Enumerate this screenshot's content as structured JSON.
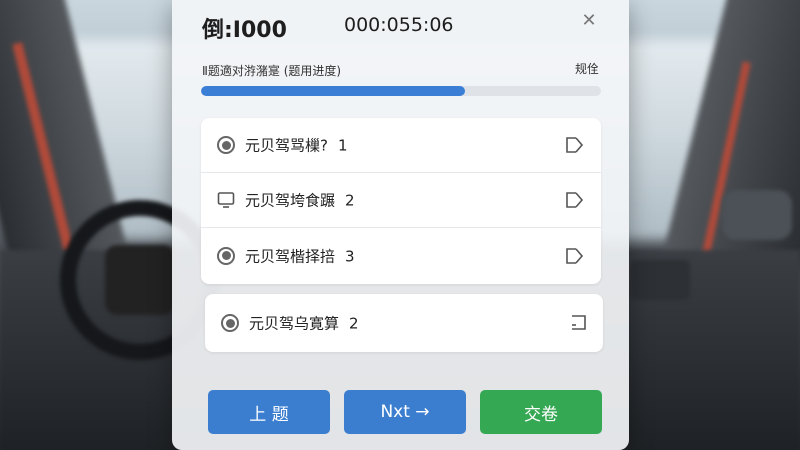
{
  "header": {
    "title": "倒:Ⅰ000",
    "timer": "000:055:06"
  },
  "progress": {
    "label": "Ⅱ题適对㳺潴寔 (题用进度)",
    "right_label": "规佺",
    "percent": 66,
    "fill_color": "#3a7fd5"
  },
  "questions": [
    {
      "icon": "radio-icon",
      "label": "元贝驾骂樔?",
      "number": "1",
      "action_icon": "exit-icon"
    },
    {
      "icon": "monitor-icon",
      "label": "元贝驾垮食蹍",
      "number": "2",
      "action_icon": "exit-icon"
    },
    {
      "icon": "radio-icon",
      "label": "元贝驾楷择掊",
      "number": "3",
      "action_icon": "exit-icon"
    },
    {
      "icon": "radio-icon",
      "label": "元贝驾乌寛算",
      "number": "2",
      "action_icon": "note-icon"
    }
  ],
  "buttons": {
    "prev": "上  题",
    "next": "Nxt →",
    "submit": "交卷"
  },
  "colors": {
    "primary": "#3b7ed0",
    "success": "#35a853"
  }
}
